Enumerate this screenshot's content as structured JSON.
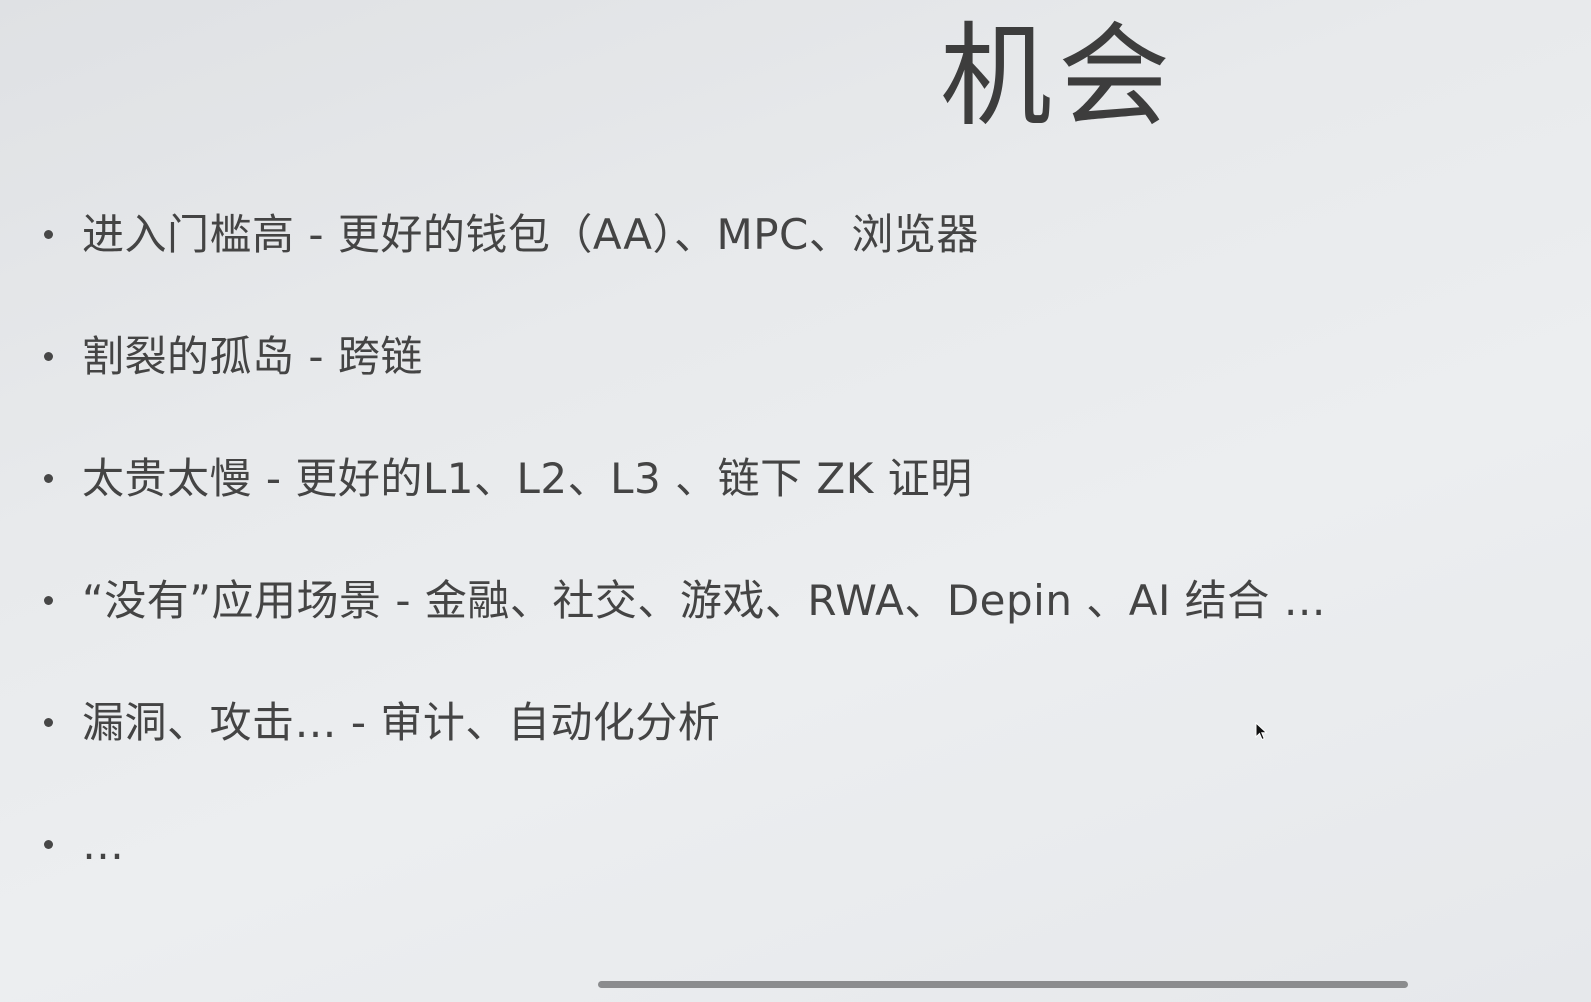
{
  "slide": {
    "title": "机会",
    "bullets": [
      {
        "text": "进入门槛高 - 更好的钱包（AA）、MPC、浏览器"
      },
      {
        "text": "割裂的孤岛 - 跨链"
      },
      {
        "text": "太贵太慢 - 更好的L1、L2、L3 、链下 ZK 证明"
      },
      {
        "text": "“没有”应用场景 - 金融、社交、游戏、RWA、Depin 、AI 结合 …"
      },
      {
        "text": "漏洞、攻击… - 审计、自动化分析"
      },
      {
        "text": "…"
      }
    ]
  },
  "icons": {
    "cursor": "mouse-pointer-icon",
    "bullet": "bullet-dot-icon"
  },
  "colors": {
    "background": "#e9ebed",
    "text": "#444444",
    "title": "#3d3d3d",
    "scrollbar": "#8b8c8e"
  }
}
